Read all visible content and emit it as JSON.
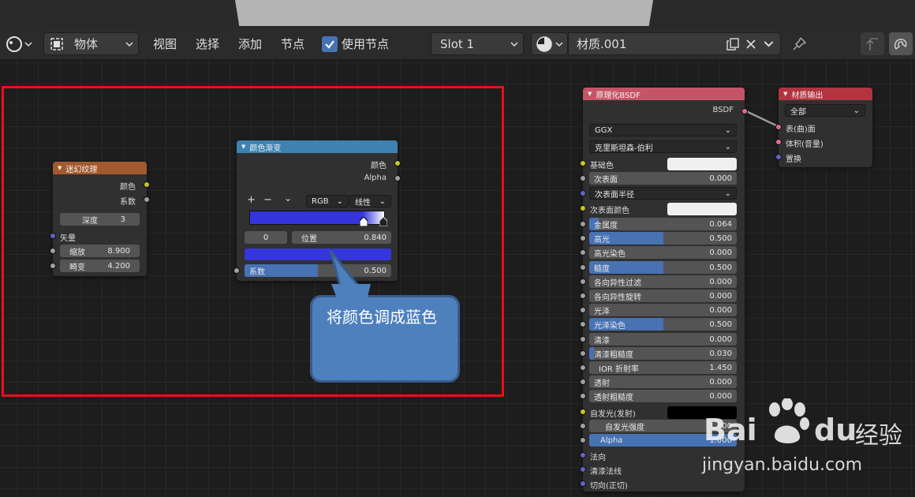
{
  "header": {
    "object_mode": "物体",
    "menus": [
      "视图",
      "选择",
      "添加",
      "节点"
    ],
    "use_nodes_label": "使用节点",
    "slot": "Slot 1",
    "material_name": "材质.001"
  },
  "nodes": {
    "magic": {
      "title": "迷幻纹理",
      "outputs": [
        "颜色",
        "系数"
      ],
      "depth_label": "深度",
      "depth_value": "3",
      "vector_label": "矢量",
      "scale_label": "缩放",
      "scale_value": "8.900",
      "distortion_label": "畸变",
      "distortion_value": "4.200"
    },
    "ramp": {
      "title": "颜色渐变",
      "outputs": [
        "颜色",
        "Alpha"
      ],
      "tools": [
        "+",
        "−",
        "⌄"
      ],
      "color_mode": "RGB",
      "interpolation": "线性",
      "stop_index": "0",
      "pos_label": "位置",
      "pos_value": "0.840",
      "fac_label": "系数",
      "fac_value": "0.500",
      "selected_color": "#3535dd"
    },
    "bsdf": {
      "title": "原理化BSDF",
      "output": "BSDF",
      "distribution": "GGX",
      "subsurface_method": "克里斯坦森-伯利",
      "base_color_label": "基础色",
      "subsurface_label": "次表面",
      "subsurface_value": "0.000",
      "subsurface_radius_label": "次表面半径",
      "subsurface_color_label": "次表面颜色",
      "rows": [
        {
          "label": "金属度",
          "value": "0.064",
          "fill": 0.064
        },
        {
          "label": "高光",
          "value": "0.500",
          "fill": 0.5
        },
        {
          "label": "高光染色",
          "value": "0.000",
          "fill": 0
        },
        {
          "label": "糙度",
          "value": "0.500",
          "fill": 0.5
        },
        {
          "label": "各向异性过滤",
          "value": "0.000",
          "fill": 0
        },
        {
          "label": "各向异性旋转",
          "value": "0.000",
          "fill": 0
        },
        {
          "label": "光泽",
          "value": "0.000",
          "fill": 0
        },
        {
          "label": "光泽染色",
          "value": "0.500",
          "fill": 0.5
        },
        {
          "label": "清漆",
          "value": "0.000",
          "fill": 0
        },
        {
          "label": "清漆粗糙度",
          "value": "0.030",
          "fill": 0.03
        },
        {
          "label": "IOR 折射率",
          "value": "1.450",
          "fill": 0
        },
        {
          "label": "透射",
          "value": "0.000",
          "fill": 0
        },
        {
          "label": "透射粗糙度",
          "value": "0.000",
          "fill": 0
        }
      ],
      "emission_label": "自发光(发射)",
      "emission_strength_label": "自发光强度",
      "emission_strength_value": "1.000",
      "alpha_label": "Alpha",
      "alpha_value": "1.000",
      "normal_label": "法向",
      "clearcoat_normal_label": "清漆法线",
      "tangent_label": "切向(正切)"
    },
    "output": {
      "title": "材质输出",
      "target": "全部",
      "sockets": [
        "表(曲)面",
        "体积(音量)",
        "置换"
      ]
    }
  },
  "callout_text": "将颜色调成蓝色",
  "watermark": {
    "brand": "Bai",
    "brand2": "du",
    "cn": "经验",
    "url": "jingyan.baidu.com"
  }
}
